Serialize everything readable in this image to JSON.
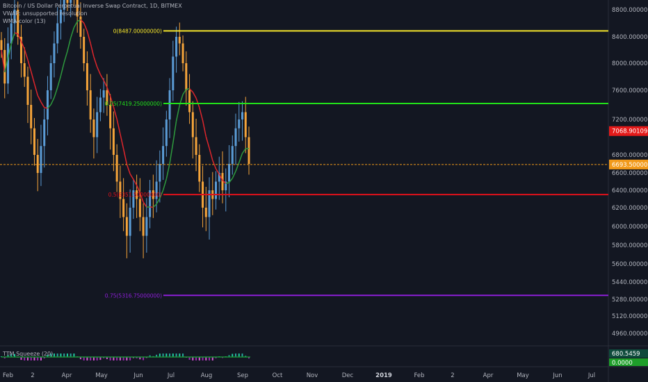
{
  "legend": {
    "title": "Bitcoin / US Dollar Perpetual Inverse Swap Contract, 1D, BITMEX",
    "vwap": "VWAP: unsupported resolution",
    "wma": "WMA-color (13)"
  },
  "colors": {
    "background": "#131722",
    "up": "#5b9cd6",
    "down": "#f5a43a",
    "wma_fast_red": "#e0262c",
    "wma_green": "#2e9b3e",
    "fib_0": "#f5e52a",
    "fib_025": "#22e21a",
    "fib_05": "#e0111b",
    "fib_075": "#8e1ed8",
    "current_price": "#f29a1b",
    "last_price_label": "#e31a1a"
  },
  "fib_levels": [
    {
      "id": "fib-0",
      "label": "0(8487.00000000)",
      "price": 8487
    },
    {
      "id": "fib-025",
      "label": "0.25(7419.25000000)",
      "price": 7419.25
    },
    {
      "id": "fib-05",
      "label": "0.5(6351.50000000)",
      "price": 6351.5
    },
    {
      "id": "fib-075",
      "label": "0.75(5316.75000000)",
      "price": 5316.75
    }
  ],
  "price_axis": {
    "ticks": [
      "8800.00000000",
      "8400.00000000",
      "8000.00000000",
      "7600.00000000",
      "7200.00000000",
      "6800.00000000",
      "6600.00000000",
      "6400.00000000",
      "6200.00000000",
      "6000.00000000",
      "5800.00000000",
      "5600.00000000",
      "5440.00000000",
      "5280.00000000",
      "5120.00000000",
      "4960.00000000"
    ],
    "tick_values": [
      8800,
      8400,
      8000,
      7600,
      7200,
      6800,
      6600,
      6400,
      6200,
      6000,
      5800,
      5600,
      5440,
      5280,
      5120,
      4960
    ],
    "last_price_label": "7068.90109890",
    "last_price": 7068.9,
    "current_price_label": "6693.50000000",
    "current_price": 6693.5
  },
  "indicator": {
    "name": "TTM Squeeze (20)",
    "value": "680.5459",
    "zero_label": "0.0000"
  },
  "time_axis": {
    "labels": [
      "Feb",
      "2",
      "Apr",
      "May",
      "Jun",
      "Jul",
      "Aug",
      "Sep",
      "Oct",
      "Nov",
      "Dec",
      "2019",
      "Feb",
      "2",
      "Apr",
      "May",
      "Jun",
      "Jul"
    ]
  },
  "chart_data": {
    "type": "candlestick",
    "title": "Bitcoin / US Dollar Perpetual Inverse Swap Contract, 1D, BITMEX",
    "y_range": [
      4880,
      8880
    ],
    "x_range_months": [
      "Feb 2018",
      "Jul 2019"
    ],
    "closes": [
      8200,
      7700,
      8300,
      8600,
      8800,
      8400,
      8000,
      7800,
      7400,
      7100,
      6800,
      6600,
      6900,
      7200,
      7600,
      8000,
      8300,
      8600,
      8800,
      9000,
      8900,
      9200,
      9000,
      8700,
      8400,
      8000,
      7600,
      7200,
      7000,
      7300,
      7500,
      7600,
      7400,
      7100,
      6800,
      6500,
      6300,
      6100,
      5900,
      6200,
      6400,
      6300,
      6100,
      5900,
      6100,
      6400,
      6300,
      6500,
      6700,
      6900,
      7200,
      7600,
      8100,
      8400,
      8300,
      8000,
      7600,
      7300,
      7000,
      6800,
      6500,
      6200,
      6100,
      6400,
      6300,
      6500,
      6600,
      6400,
      6500,
      6700,
      6900,
      7100,
      7200,
      7300,
      7000,
      6700
    ]
  }
}
